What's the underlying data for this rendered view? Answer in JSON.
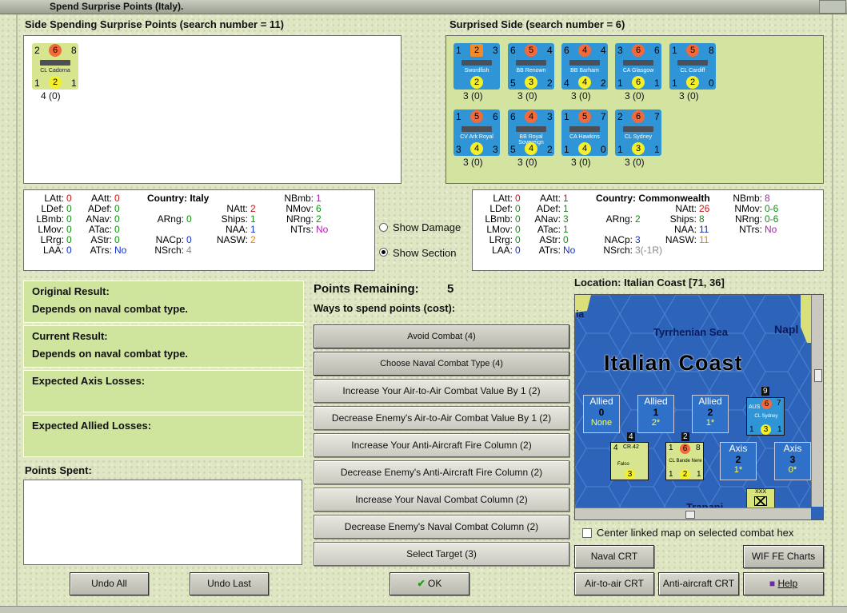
{
  "window": {
    "title": "Spend Surprise Points (Italy)."
  },
  "left_side": {
    "header": "Side Spending Surprise Points (search number = 11)",
    "units": [
      {
        "top_left": "2",
        "top_mid": "6",
        "top_right": "8",
        "name": "CL Cadorna",
        "bot_left": "1",
        "bot_mid": "2",
        "bot_right": "1",
        "caption": "4 (0)"
      }
    ]
  },
  "right_side": {
    "header": "Surprised Side (search number = 6)",
    "units": [
      {
        "tl": "1",
        "tm": "2",
        "tr": "3",
        "name": "Swordfish",
        "bl": "",
        "bm": "2",
        "br": "",
        "caption": "3 (0)"
      },
      {
        "tl": "6",
        "tm": "5",
        "tr": "4",
        "name": "BB Renown",
        "bl": "5",
        "bm": "3",
        "br": "2",
        "caption": "3 (0)"
      },
      {
        "tl": "6",
        "tm": "4",
        "tr": "4",
        "name": "BB Barham",
        "bl": "4",
        "bm": "4",
        "br": "2",
        "caption": "3 (0)"
      },
      {
        "tl": "3",
        "tm": "6",
        "tr": "6",
        "name": "CA Glasgow",
        "bl": "1",
        "bm": "6",
        "br": "1",
        "caption": "3 (0)"
      },
      {
        "tl": "1",
        "tm": "5",
        "tr": "8",
        "name": "CL Cardiff",
        "bl": "1",
        "bm": "2",
        "br": "0",
        "caption": "3 (0)"
      },
      {
        "tl": "1",
        "tm": "5",
        "tr": "6",
        "name": "CV Ark Royal",
        "bl": "3",
        "bm": "4",
        "br": "3",
        "caption": "3 (0)"
      },
      {
        "tl": "6",
        "tm": "4",
        "tr": "3",
        "name": "BB Royal Sovereign",
        "bl": "5",
        "bm": "4",
        "br": "2",
        "caption": "3 (0)"
      },
      {
        "tl": "1",
        "tm": "5",
        "tr": "7",
        "name": "CA Hawkins",
        "bl": "1",
        "bm": "4",
        "br": "0",
        "caption": "3 (0)"
      },
      {
        "tl": "2",
        "tm": "6",
        "tr": "7",
        "name": "CL Sydney",
        "bl": "1",
        "bm": "3",
        "br": "1",
        "caption": "3 (0)"
      }
    ]
  },
  "italy_stats": {
    "country_label": "Country:",
    "country": "Italy",
    "c1": [
      [
        "LAtt:",
        "0"
      ],
      [
        "LDef:",
        "0"
      ],
      [
        "LBmb:",
        "0"
      ],
      [
        "LMov:",
        "0"
      ],
      [
        "LRrg:",
        "0"
      ],
      [
        "LAA:",
        "0"
      ]
    ],
    "c2": [
      [
        "AAtt:",
        "0"
      ],
      [
        "ADef:",
        "0"
      ],
      [
        "ANav:",
        "0"
      ],
      [
        "ATac:",
        "0"
      ],
      [
        "AStr:",
        "0"
      ],
      [
        "ATrs:",
        "No"
      ]
    ],
    "c3": [
      [
        "ARng:",
        "0"
      ],
      [
        "NACp:",
        "0"
      ],
      [
        "NSrch:",
        "4"
      ]
    ],
    "c4": [
      [
        "NAtt:",
        "2"
      ],
      [
        "Ships:",
        "1"
      ],
      [
        "NAA:",
        "1"
      ],
      [
        "NASW:",
        "2"
      ]
    ],
    "c5": [
      [
        "NBmb:",
        "1"
      ],
      [
        "NMov:",
        "6"
      ],
      [
        "NRng:",
        "2"
      ],
      [
        "NTrs:",
        "No"
      ]
    ]
  },
  "commonwealth_stats": {
    "country_label": "Country:",
    "country": "Commonwealth",
    "c1": [
      [
        "LAtt:",
        "0"
      ],
      [
        "LDef:",
        "0"
      ],
      [
        "LBmb:",
        "0"
      ],
      [
        "LMov:",
        "0"
      ],
      [
        "LRrg:",
        "0"
      ],
      [
        "LAA:",
        "0"
      ]
    ],
    "c2": [
      [
        "AAtt:",
        "1"
      ],
      [
        "ADef:",
        "1"
      ],
      [
        "ANav:",
        "3"
      ],
      [
        "ATac:",
        "1"
      ],
      [
        "AStr:",
        "0"
      ],
      [
        "ATrs:",
        "No"
      ]
    ],
    "c3": [
      [
        "ARng:",
        "2"
      ],
      [
        "NACp:",
        "3"
      ],
      [
        "NSrch:",
        "3(-1R)"
      ]
    ],
    "c4": [
      [
        "NAtt:",
        "26"
      ],
      [
        "Ships:",
        "8"
      ],
      [
        "NAA:",
        "11"
      ],
      [
        "NASW:",
        "11"
      ]
    ],
    "c5": [
      [
        "NBmb:",
        "8"
      ],
      [
        "NMov:",
        "0-6"
      ],
      [
        "NRng:",
        "0-6"
      ],
      [
        "NTrs:",
        "No"
      ]
    ]
  },
  "options": {
    "show_damage": "Show Damage",
    "show_section": "Show Section"
  },
  "results": {
    "original_label": "Original Result:",
    "original_value": "Depends on naval combat type.",
    "current_label": "Current Result:",
    "current_value": "Depends on naval combat type.",
    "axis_losses_label": "Expected Axis Losses:",
    "allied_losses_label": "Expected Allied Losses:",
    "points_spent_label": "Points Spent:"
  },
  "points": {
    "remaining_label": "Points Remaining:",
    "remaining_value": "5",
    "ways_label": "Ways to spend points (cost):"
  },
  "actions": [
    "Avoid Combat (4)",
    "Choose Naval Combat Type (4)",
    "Increase Your Air-to-Air Combat Value By 1 (2)",
    "Decrease Enemy's Air-to-Air Combat Value By 1 (2)",
    "Increase Your Anti-Aircraft Fire Column (2)",
    "Decrease Enemy's Anti-Aircraft Fire Column (2)",
    "Increase Your Naval Combat Column (2)",
    "Decrease Enemy's Naval Combat Column (2)",
    "Select Target (3)"
  ],
  "location": {
    "label": "Location: Italian Coast [71, 36]",
    "map_title": "Italian Coast",
    "sea_label": "Tyrrhenian Sea",
    "town": "Napl",
    "bottom_town": "Trapani",
    "badge_label": "XXX",
    "allied_boxes": [
      {
        "t": "Allied",
        "v": "0",
        "s": "None"
      },
      {
        "t": "Allied",
        "v": "1",
        "s": "2*"
      },
      {
        "t": "Allied",
        "v": "2",
        "s": "1*"
      }
    ],
    "axis_boxes": [
      {
        "t": "Axis",
        "v": "2",
        "s": "1*"
      },
      {
        "t": "Axis",
        "v": "3",
        "s": "0*"
      }
    ],
    "falco": {
      "tl": "4",
      "name": "CR.42",
      "name2": "Falco",
      "mid": "3",
      "stack": "4"
    },
    "bande": {
      "tl": "1",
      "tm": "6",
      "tr": "8",
      "name": "CL Bande Nere",
      "bl": "1",
      "bm": "2",
      "br": "1",
      "stack": "2"
    },
    "sydney": {
      "tl": "2",
      "tm": "6",
      "tr": "7",
      "name": "CL Sydney",
      "bl": "1",
      "bm": "3",
      "br": "1",
      "stack": "9",
      "aus": "AUS"
    }
  },
  "center_map": "Center linked map on selected combat hex",
  "buttons": {
    "undo_all": "Undo All",
    "undo_last": "Undo Last",
    "ok": "OK",
    "naval_crt": "Naval CRT",
    "wif_charts": "WIF FE Charts",
    "air_crt": "Air-to-air CRT",
    "aa_crt": "Anti-aircraft CRT",
    "help": "Help"
  },
  "colors": {
    "counter_yellow": "#d7e68e",
    "counter_blue": "#2f95d6",
    "value_red": "#d01010",
    "value_green": "#109010",
    "value_blue": "#1030d0",
    "value_purple": "#b020b0",
    "value_orange": "#e08010"
  }
}
